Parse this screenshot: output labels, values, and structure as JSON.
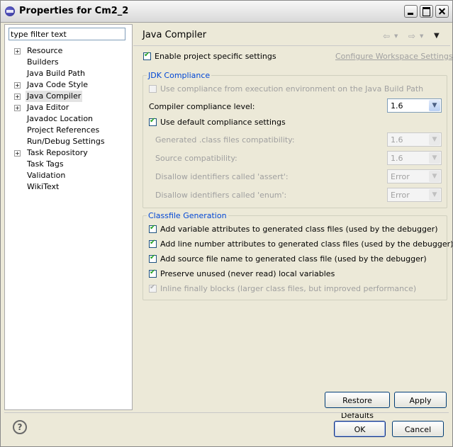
{
  "window": {
    "title": "Properties for Cm2_2"
  },
  "filter": {
    "value": "type filter text"
  },
  "tree": [
    {
      "label": "Resource",
      "expandable": true
    },
    {
      "label": "Builders",
      "expandable": false
    },
    {
      "label": "Java Build Path",
      "expandable": false
    },
    {
      "label": "Java Code Style",
      "expandable": true
    },
    {
      "label": "Java Compiler",
      "expandable": true,
      "selected": true
    },
    {
      "label": "Java Editor",
      "expandable": true
    },
    {
      "label": "Javadoc Location",
      "expandable": false
    },
    {
      "label": "Project References",
      "expandable": false
    },
    {
      "label": "Run/Debug Settings",
      "expandable": false
    },
    {
      "label": "Task Repository",
      "expandable": true
    },
    {
      "label": "Task Tags",
      "expandable": false
    },
    {
      "label": "Validation",
      "expandable": false
    },
    {
      "label": "WikiText",
      "expandable": false
    }
  ],
  "page": {
    "title": "Java Compiler",
    "enable_specific": "Enable project specific settings",
    "configure_link": "Configure Workspace Settings..."
  },
  "jdk": {
    "title": "JDK Compliance",
    "use_env": "Use compliance from execution environment on the Java Build Path",
    "compliance_label": "Compiler compliance level:",
    "compliance_value": "1.6",
    "use_default": "Use default compliance settings",
    "generated_label": "Generated .class files compatibility:",
    "generated_value": "1.6",
    "source_label": "Source compatibility:",
    "source_value": "1.6",
    "assert_label": "Disallow identifiers called 'assert':",
    "assert_value": "Error",
    "enum_label": "Disallow identifiers called 'enum':",
    "enum_value": "Error"
  },
  "classfile": {
    "title": "Classfile Generation",
    "opt1": "Add variable attributes to generated class files (used by the debugger)",
    "opt2": "Add line number attributes to generated class files (used by the debugger)",
    "opt3": "Add source file name to generated class file (used by the debugger)",
    "opt4": "Preserve unused (never read) local variables",
    "opt5": "Inline finally blocks (larger class files, but improved performance)"
  },
  "buttons": {
    "restore": "Restore Defaults",
    "apply": "Apply",
    "ok": "OK",
    "cancel": "Cancel"
  },
  "icons": {
    "help": "?",
    "back": "⇦",
    "forward": "⇨",
    "menu": "▼",
    "combo_arrow": "▼"
  }
}
